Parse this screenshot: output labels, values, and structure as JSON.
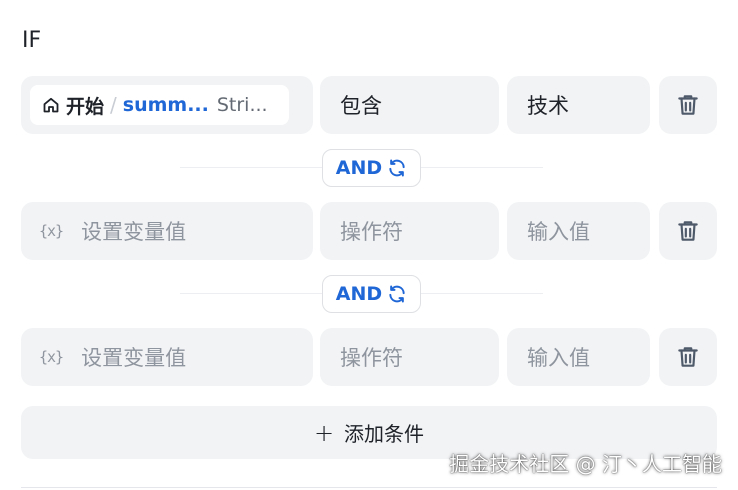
{
  "header": {
    "label": "IF"
  },
  "conditions": [
    {
      "variable": {
        "node": "开始",
        "separator": "/",
        "name": "summ...",
        "type": "Stri..."
      },
      "operator": "包含",
      "value": "技术"
    },
    {
      "variable_placeholder": "设置变量值",
      "variable_icon": "{x}",
      "operator_placeholder": "操作符",
      "value_placeholder": "输入值"
    },
    {
      "variable_placeholder": "设置变量值",
      "variable_icon": "{x}",
      "operator_placeholder": "操作符",
      "value_placeholder": "输入值"
    }
  ],
  "logic": {
    "label": "AND"
  },
  "add_button": {
    "icon": "+",
    "label": "添加条件"
  },
  "watermark": "掘金技术社区 @ 汀丶人工智能",
  "icons": {
    "home": "home-icon",
    "variable": "variable-icon",
    "swap": "refresh-icon",
    "delete": "trash-icon"
  },
  "colors": {
    "accent": "#1f66d6",
    "cell_bg": "#f2f3f5",
    "placeholder": "#8f959e"
  }
}
